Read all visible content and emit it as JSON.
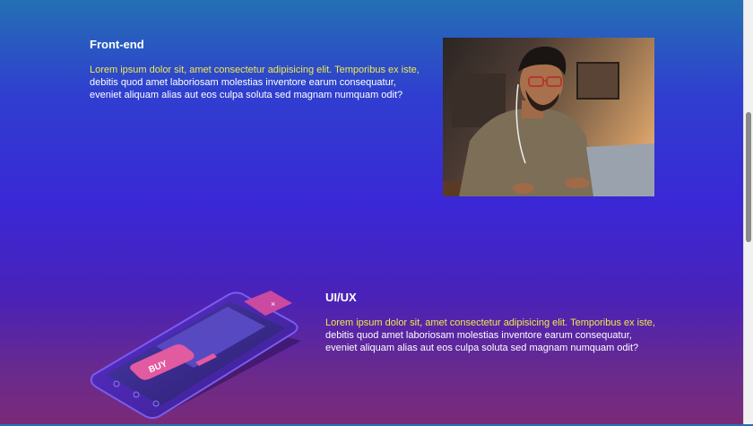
{
  "sections": [
    {
      "title": "Front-end",
      "text_highlight": "Lorem ipsum dolor sit, amet consectetur adipisicing elit. Temporibus ex iste,",
      "text_rest": "debitis quod amet laboriosam molestias inventore earum consequatur, eveniet aliquam alias aut eos culpa soluta sed magnam numquam odit?"
    },
    {
      "title": "UI/UX",
      "text_highlight": "Lorem ipsum dolor sit, amet consectetur adipisicing elit. Temporibus ex iste,",
      "text_rest": "debitis quod amet laboriosam molestias inventore earum consequatur, eveniet aliquam alias aut eos culpa soluta sed magnam numquam odit?"
    }
  ],
  "phone_button_label": "BUY",
  "phone_x_label": "×",
  "colors": {
    "highlight": "#f1e94b",
    "phone_accent": "#e25aa0"
  }
}
